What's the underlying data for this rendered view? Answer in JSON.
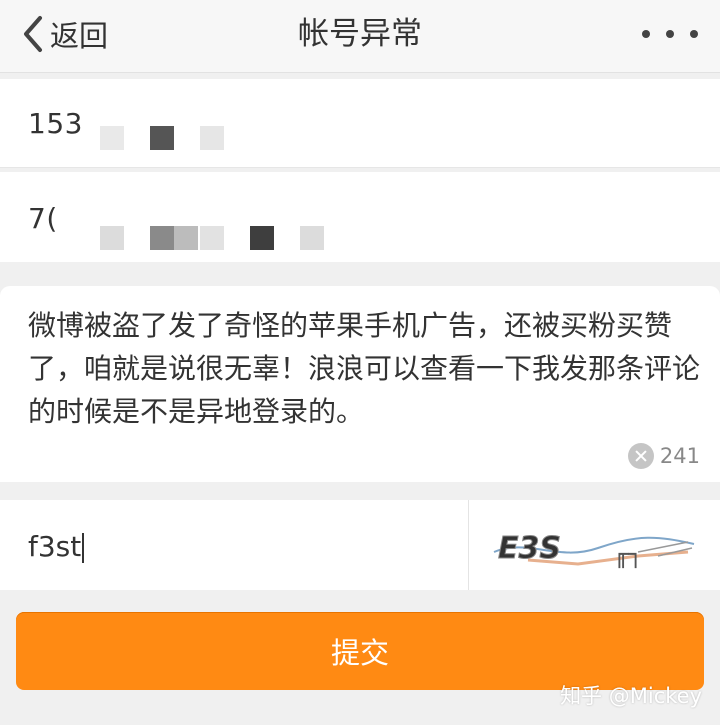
{
  "header": {
    "back_label": "返回",
    "title": "帐号异常",
    "more_icon": "more-dots-icon"
  },
  "form": {
    "phone_value": "153",
    "second_value": "7(",
    "description": "微博被盗了发了奇怪的苹果手机广告，还被买粉买赞了，咱就是说很无辜！浪浪可以查看一下我发那条评论的时候是不是异地登录的。",
    "char_count": "241",
    "captcha_value": "f3st",
    "captcha_image_text": "E3S",
    "submit_label": "提交"
  },
  "watermark": "知乎 @Mickey",
  "colors": {
    "accent": "#ff8a13",
    "background": "#f0f0f0"
  }
}
